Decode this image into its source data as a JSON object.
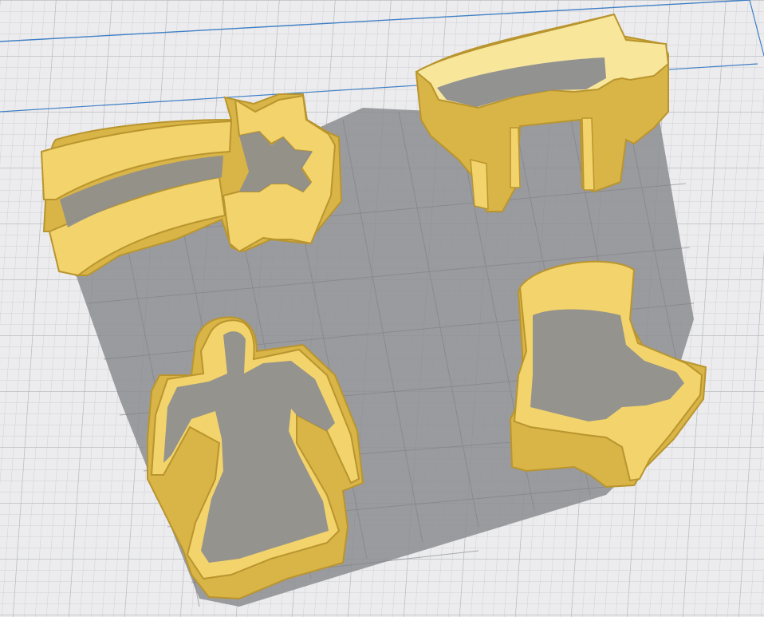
{
  "viewport": {
    "colors": {
      "background": "#e9eaec",
      "build_plate": "#ececee",
      "grid_minor": "#cfd1d5",
      "grid_major": "#b3b6bc",
      "volume_edge": "#3f7fc4",
      "shadow": "#8c8d90",
      "model_fill": "#f3d36b",
      "model_light": "#f8e79a",
      "model_dark": "#d9b446",
      "model_edge": "#b9952f"
    },
    "models": [
      {
        "name": "shooting-star-cutter"
      },
      {
        "name": "cow-cutter"
      },
      {
        "name": "angel-cutter"
      },
      {
        "name": "bell-cutter"
      }
    ]
  }
}
